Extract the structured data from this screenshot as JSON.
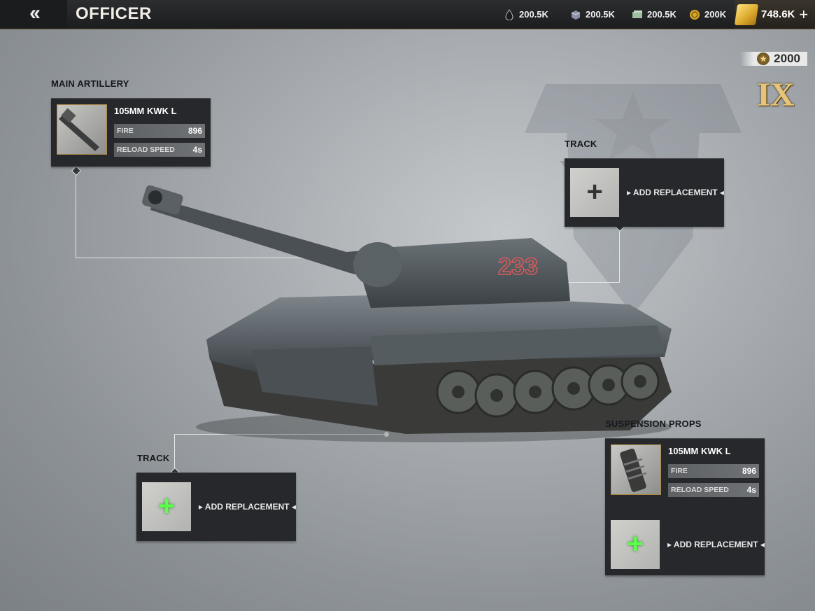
{
  "header": {
    "back_icon": "double-chevron-left-icon",
    "title": "OFFICER",
    "resources": [
      {
        "name": "oil-icon",
        "value": "200.5K"
      },
      {
        "name": "steel-icon",
        "value": "200.5K"
      },
      {
        "name": "cash-icon",
        "value": "200.5K"
      },
      {
        "name": "coin-icon",
        "value": "200K"
      }
    ],
    "gold": {
      "value": "748.6K",
      "plus": "+"
    }
  },
  "rank": {
    "score": "2000",
    "tier": "IX"
  },
  "slots": {
    "main_artillery": {
      "label": "MAIN ARTILLERY",
      "item_name": "105MM KWK L",
      "stats": [
        {
          "key": "FIRE",
          "value": "896"
        },
        {
          "key": "RELOAD SPEED",
          "value": "4s"
        }
      ]
    },
    "track_right": {
      "label": "TRACK",
      "action": "ADD REPLACEMENT",
      "plus": "+"
    },
    "track_left": {
      "label": "TRACK",
      "action": "ADD REPLACEMENT",
      "plus": "+"
    },
    "suspension_props": {
      "label": "SUSPENSION PROPS",
      "item_name": "105MM KWK L",
      "stats": [
        {
          "key": "FIRE",
          "value": "896"
        },
        {
          "key": "RELOAD SPEED",
          "value": "4s"
        }
      ],
      "action": "ADD REPLACEMENT",
      "plus": "+"
    }
  },
  "tank": {
    "hull_number": "233"
  },
  "colors": {
    "accent_gold": "#d9a62a",
    "plus_green": "#5cff4a",
    "panel_bg": "#26282b"
  }
}
